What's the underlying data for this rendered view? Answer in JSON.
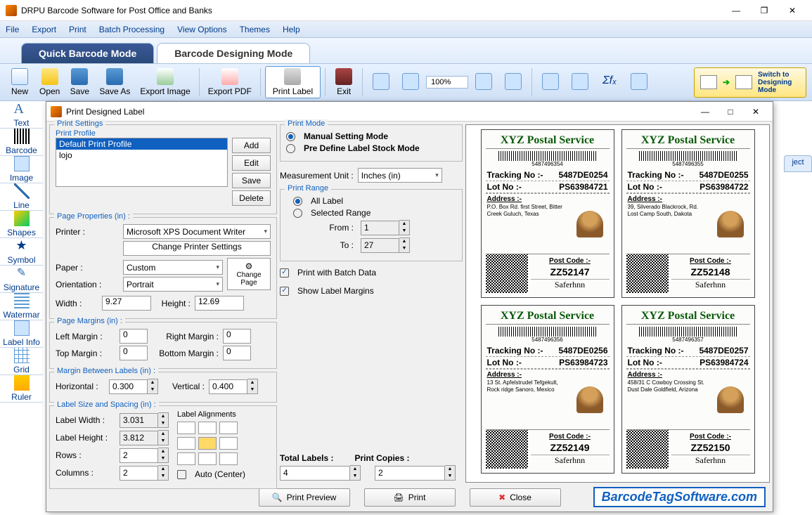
{
  "app": {
    "title": "DRPU Barcode Software for Post Office and Banks"
  },
  "menu": [
    "File",
    "Export",
    "Print",
    "Batch Processing",
    "View Options",
    "Themes",
    "Help"
  ],
  "modeTabs": {
    "quick": "Quick Barcode Mode",
    "design": "Barcode Designing Mode"
  },
  "ribbon": {
    "new": "New",
    "open": "Open",
    "save": "Save",
    "saveAs": "Save As",
    "exportImage": "Export Image",
    "exportPdf": "Export PDF",
    "printLabel": "Print Label",
    "exit": "Exit",
    "zoom": "100%",
    "switch": "Switch to Designing Mode"
  },
  "leftTools": [
    "Text",
    "Barcode",
    "Image",
    "Line",
    "Shapes",
    "Symbol",
    "Signature",
    "Watermar",
    "Label Info",
    "Grid",
    "Ruler"
  ],
  "rightTab": "ject",
  "dialog": {
    "title": "Print Designed Label",
    "printSettings": "Print Settings",
    "printProfileLabel": "Print Profile",
    "profiles": [
      "Default Print Profile",
      "lojo"
    ],
    "btnAdd": "Add",
    "btnEdit": "Edit",
    "btnSave": "Save",
    "btnDelete": "Delete",
    "pageProps": "Page Properties (in) :",
    "printerLabel": "Printer :",
    "printer": "Microsoft XPS Document Writer",
    "changePrinter": "Change Printer Settings",
    "paperLabel": "Paper :",
    "paper": "Custom",
    "orientationLabel": "Orientation :",
    "orientation": "Portrait",
    "widthLabel": "Width :",
    "width": "9.27",
    "heightLabel": "Height :",
    "height": "12.69",
    "changePage": "Change Page",
    "pageMargins": "Page Margins (in) :",
    "leftMargin": "Left Margin :",
    "leftMarginV": "0",
    "rightMargin": "Right Margin :",
    "rightMarginV": "0",
    "topMargin": "Top Margin :",
    "topMarginV": "0",
    "bottomMargin": "Bottom Margin :",
    "bottomMarginV": "0",
    "marginBetween": "Margin Between Labels (in) :",
    "horizontal": "Horizontal :",
    "horizontalV": "0.300",
    "vertical": "Vertical :",
    "verticalV": "0.400",
    "labelSize": "Label Size and Spacing (in) :",
    "labelWidth": "Label Width :",
    "labelWidthV": "3.031",
    "labelHeight": "Label Height :",
    "labelHeightV": "3.812",
    "rows": "Rows :",
    "rowsV": "2",
    "columns": "Columns :",
    "columnsV": "2",
    "labelAlign": "Label Alignments",
    "autoCenter": "Auto (Center)",
    "printMode": "Print Mode",
    "manualMode": "Manual Setting Mode",
    "predefMode": "Pre Define Label Stock Mode",
    "measUnit": "Measurement Unit :",
    "measUnitV": "Inches (in)",
    "printRange": "Print Range",
    "allLabel": "All Label",
    "selRange": "Selected Range",
    "from": "From :",
    "fromV": "1",
    "to": "To :",
    "toV": "27",
    "batchData": "Print with Batch Data",
    "showMargins": "Show Label Margins",
    "totalLabels": "Total Labels :",
    "totalLabelsV": "4",
    "printCopies": "Print Copies :",
    "printCopiesV": "2",
    "preview": "Print Preview",
    "print": "Print",
    "close": "Close",
    "branding": "BarcodeTagSoftware.com"
  },
  "labels": [
    {
      "company": "XYZ Postal Service",
      "bcnum": "5487496354",
      "tracking": "5487DE0254",
      "lot": "PS63984721",
      "addr": "P.O. Box Rd. first Street, Bitter Creek Guluch, Texas",
      "postcode": "ZZ52147",
      "sig": "Saferhnn"
    },
    {
      "company": "XYZ Postal Service",
      "bcnum": "5487496355",
      "tracking": "5487DE0255",
      "lot": "PS63984722",
      "addr": "39, Silverado Blackrock, Rd. Lost Camp South, Dakota",
      "postcode": "ZZ52148",
      "sig": "Saferhnn"
    },
    {
      "company": "XYZ Postal Service",
      "bcnum": "5487496356",
      "tracking": "5487DE0256",
      "lot": "PS63984723",
      "addr": "13 St. Apfelstrudel Tefgekult, Rock ridge Sanoro, Mexico",
      "postcode": "ZZ52149",
      "sig": "Saferhnn"
    },
    {
      "company": "XYZ Postal Service",
      "bcnum": "5487496357",
      "tracking": "5487DE0257",
      "lot": "PS63984724",
      "addr": "458/31 C Cowboy Crossing St. Dust Dale Goldfield, Arizona",
      "postcode": "ZZ52150",
      "sig": "Saferhnn"
    }
  ],
  "labelFields": {
    "tracking": "Tracking No :-",
    "lot": "Lot No :-",
    "address": "Address :-",
    "postcode": "Post Code :-"
  }
}
